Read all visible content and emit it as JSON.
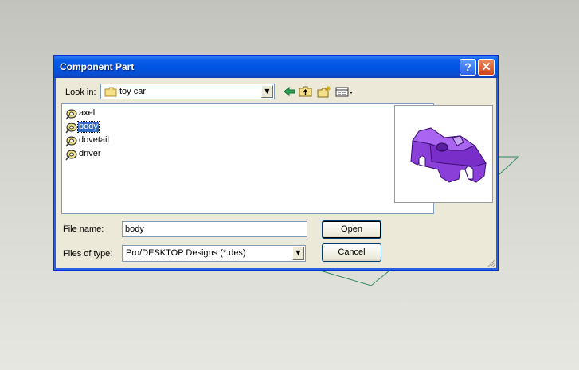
{
  "dialog": {
    "title": "Component Part",
    "help_label": "?",
    "close_label": "✕"
  },
  "look_in": {
    "label": "Look in:",
    "value": "toy car"
  },
  "toolbar": {
    "icons": [
      "back-arrow-icon",
      "up-one-level-icon",
      "new-folder-icon",
      "view-menu-icon"
    ]
  },
  "files": [
    {
      "name": "axel",
      "selected": false
    },
    {
      "name": "body",
      "selected": true
    },
    {
      "name": "dovetail",
      "selected": false
    },
    {
      "name": "driver",
      "selected": false
    }
  ],
  "file_name": {
    "label": "File name:",
    "value": "body"
  },
  "files_of_type": {
    "label": "Files of type:",
    "value": "Pro/DESKTOP Designs (*.des)"
  },
  "buttons": {
    "open": "Open",
    "cancel": "Cancel"
  },
  "colors": {
    "title_bar": "#0054e3",
    "selection": "#316ac5",
    "part_color": "#8a3fd8"
  }
}
